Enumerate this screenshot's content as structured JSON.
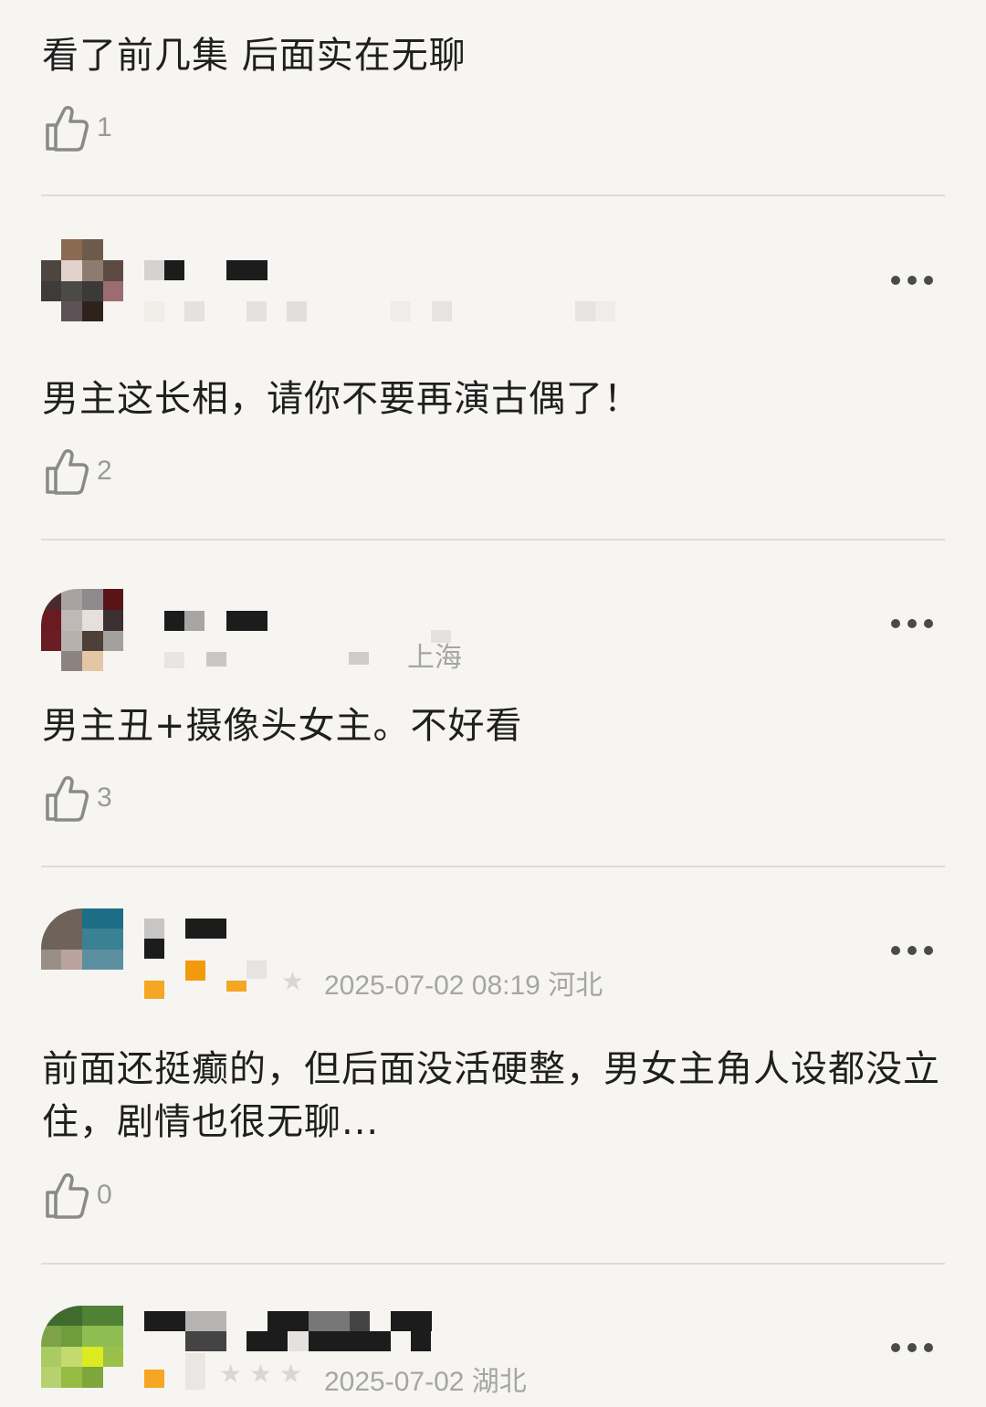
{
  "comments": [
    {
      "text": "看了前几集 后面实在无聊",
      "likes": "1"
    },
    {
      "text": "男主这长相，请你不要再演古偶了！",
      "likes": "2"
    },
    {
      "text": "男主丑+摄像头女主。不好看",
      "likes": "3",
      "location": "上海"
    },
    {
      "text": "前面还挺癫的，但后面没活硬整，男女主角人设都没立住，剧情也很无聊...",
      "likes": "0",
      "meta": "2025-07-02 08:19 河北"
    },
    {
      "meta": "2025-07-02 湖北"
    }
  ],
  "icons": {
    "like": "thumbs-up-icon",
    "more": "more-dots-icon"
  },
  "colors": {
    "background": "#f7f5f2",
    "text": "#1f1f1f",
    "muted": "#a5a5a5",
    "divider": "#dedbd8",
    "rating_accent": "#f5a623"
  }
}
